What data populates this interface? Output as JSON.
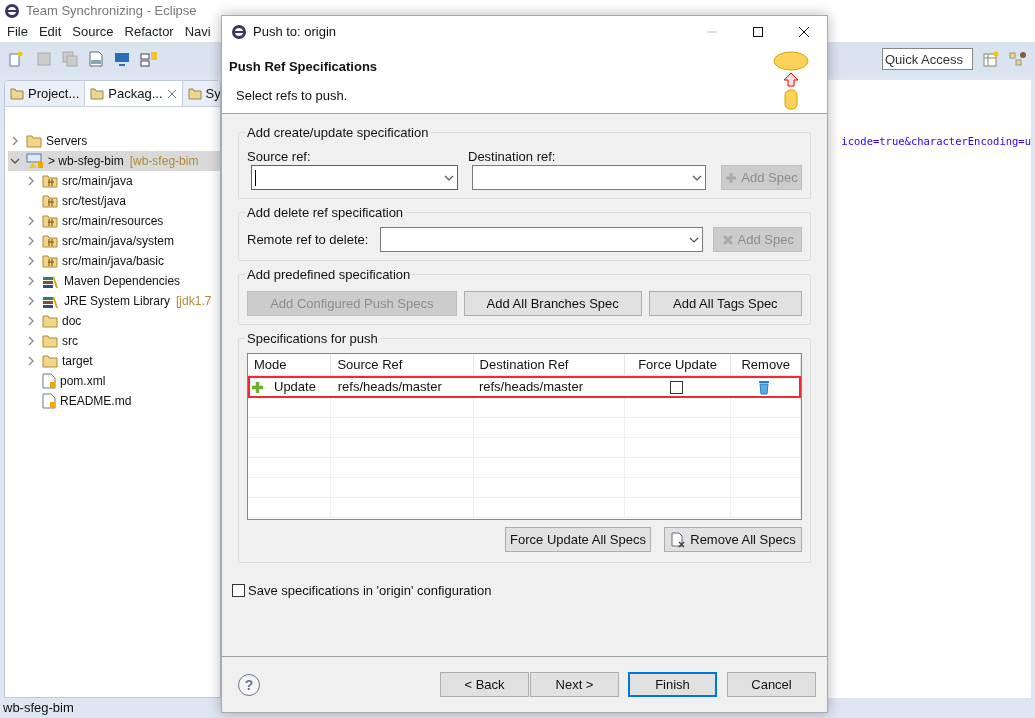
{
  "window": {
    "title": "Team Synchronizing - Eclipse"
  },
  "menu": [
    "File",
    "Edit",
    "Source",
    "Refactor",
    "Navi"
  ],
  "quick_access": {
    "placeholder": "Quick Access"
  },
  "side_tabs": [
    {
      "label": "Project...",
      "selected": false,
      "closable": false
    },
    {
      "label": "Packag...",
      "selected": true,
      "closable": true
    },
    {
      "label": "Sy",
      "selected": false,
      "closable": false
    }
  ],
  "tree": [
    {
      "label": "Servers",
      "kind": "folder",
      "expanded": false,
      "selected": false
    },
    {
      "label": "> wb-sfeg-bim",
      "extra": "[wb-sfeg-bim",
      "kind": "project",
      "expanded": true,
      "selected": true,
      "children": [
        {
          "label": "src/main/java",
          "kind": "package",
          "expanded": false,
          "selected": false
        },
        {
          "label": "src/test/java",
          "kind": "package",
          "selected": false
        },
        {
          "label": "src/main/resources",
          "kind": "package",
          "expanded": false,
          "selected": false
        },
        {
          "label": "src/main/java/system",
          "kind": "package",
          "expanded": false,
          "selected": false
        },
        {
          "label": "src/main/java/basic",
          "kind": "package",
          "expanded": false,
          "selected": false
        },
        {
          "label": "Maven Dependencies",
          "kind": "library",
          "expanded": false,
          "selected": false
        },
        {
          "label": "JRE System Library",
          "extra": "[jdk1.7",
          "kind": "library",
          "expanded": false,
          "selected": false
        },
        {
          "label": "doc",
          "kind": "folder",
          "expanded": false,
          "selected": false
        },
        {
          "label": "src",
          "kind": "folder",
          "expanded": false,
          "selected": false
        },
        {
          "label": "target",
          "kind": "folder",
          "expanded": false,
          "selected": false
        },
        {
          "label": "pom.xml",
          "kind": "file",
          "selected": false
        },
        {
          "label": "README.md",
          "kind": "file",
          "selected": false
        }
      ]
    }
  ],
  "editor": {
    "line": "icode=true&characterEncoding=u"
  },
  "status_bar": "wb-sfeg-bim",
  "dialog": {
    "title": "Push to: origin",
    "heading": "Push Ref Specifications",
    "subtitle": "Select refs to push.",
    "create_group": {
      "legend": "Add create/update specification",
      "source_label": "Source ref:",
      "destination_label": "Destination ref:",
      "button": {
        "label": "Add Spec",
        "disabled": true
      }
    },
    "delete_group": {
      "legend": "Add delete ref specification",
      "remote_label": "Remote ref to delete:",
      "button": {
        "label": "Add Spec",
        "disabled": true
      }
    },
    "predefined_group": {
      "legend": "Add predefined specification",
      "buttons": [
        {
          "label": "Add Configured Push Specs",
          "disabled": true
        },
        {
          "label": "Add All Branches Spec",
          "disabled": false
        },
        {
          "label": "Add All Tags Spec",
          "disabled": false
        }
      ]
    },
    "specs_group": {
      "legend": "Specifications for push",
      "columns": [
        "Mode",
        "Source Ref",
        "Destination Ref",
        "Force Update",
        "Remove"
      ],
      "rows": [
        {
          "mode": "Update",
          "source": "refs/heads/master",
          "destination": "refs/heads/master",
          "force_update": false,
          "highlighted": true
        }
      ],
      "buttons": [
        "Force Update All Specs",
        "Remove All Specs"
      ]
    },
    "save_checkbox": {
      "label": "Save specifications in 'origin' configuration",
      "checked": false
    },
    "help": "?",
    "footer_buttons": [
      {
        "label": "< Back",
        "default": false
      },
      {
        "label": "Next >",
        "default": false
      },
      {
        "label": "Finish",
        "default": true
      },
      {
        "label": "Cancel",
        "default": false
      }
    ]
  }
}
